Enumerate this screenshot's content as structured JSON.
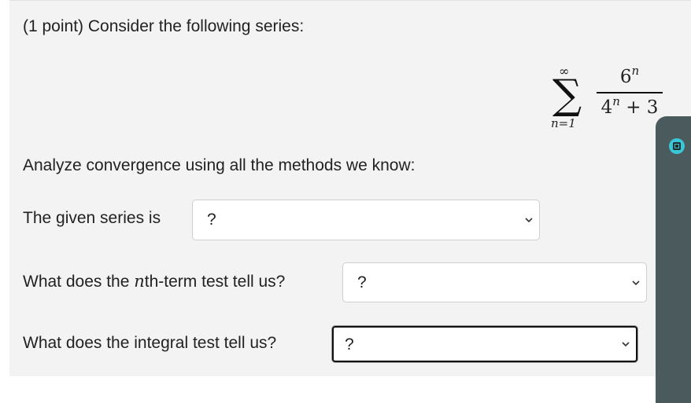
{
  "problem": {
    "heading": "(1 point) Consider the following series:",
    "series": {
      "sum_upper": "∞",
      "sum_lower": "n=1",
      "numerator_base": "6",
      "numerator_exp": "n",
      "denominator_base": "4",
      "denominator_exp": "n",
      "denominator_tail": " + 3"
    },
    "instruction": "Analyze convergence using all the methods we know:"
  },
  "questions": [
    {
      "prompt": "The given series is",
      "selected": "?"
    },
    {
      "prompt_before": "What does the ",
      "prompt_var": "n",
      "prompt_after": "th-term test tell us?",
      "selected": "?"
    },
    {
      "prompt": "What does the integral test tell us?",
      "selected": "?"
    }
  ],
  "icons": {
    "dropdown": "chevron-down-icon",
    "side_widget": "record-icon"
  },
  "colors": {
    "panel_background": "#f3f3f3",
    "side_widget": "#4b5a5c",
    "side_widget_icon": "#39c6d6"
  }
}
